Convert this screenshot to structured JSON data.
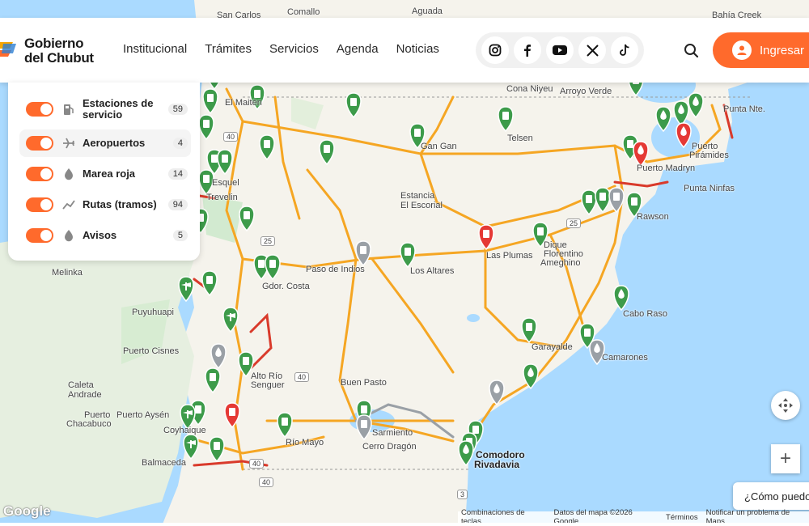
{
  "header": {
    "logo_line1": "Gobierno",
    "logo_line2": "del Chubut",
    "nav": [
      "Institucional",
      "Trámites",
      "Servicios",
      "Agenda",
      "Noticias"
    ],
    "social_icons": [
      "instagram-icon",
      "facebook-icon",
      "youtube-icon",
      "x-icon",
      "tiktok-icon"
    ],
    "login_label": "Ingresar"
  },
  "layers": [
    {
      "name": "Estaciones de servicio",
      "count": "59",
      "icon": "fuel-icon",
      "on": true
    },
    {
      "name": "Aeropuertos",
      "count": "4",
      "icon": "airplane-icon",
      "on": true
    },
    {
      "name": "Marea roja",
      "count": "14",
      "icon": "drop-icon",
      "on": true
    },
    {
      "name": "Rutas (tramos)",
      "count": "94",
      "icon": "route-icon",
      "on": true
    },
    {
      "name": "Avisos",
      "count": "5",
      "icon": "drop-icon",
      "on": true
    }
  ],
  "places": [
    "San Carlos",
    "Comallo",
    "Aguada",
    "Bahía Creek",
    "El Maitén",
    "Cona Niyeu",
    "Arroyo Verde",
    "Estancia",
    "Punta Nte.",
    "Gan Gan",
    "Telsen",
    "Puerto",
    "Pirámides",
    "Puerto Madryn",
    "Esquel",
    "Trevelin",
    "Estancia",
    "El Escorial",
    "Punta Ninfas",
    "Rawson",
    "Paso de Indios",
    "Los Altares",
    "Las Plumas",
    "Dique",
    "Florentino",
    "Ameghino",
    "Melinka",
    "Gdor. Costa",
    "Puyuhuapi",
    "Cabo Raso",
    "Puerto Cisnes",
    "Garayalde",
    "Camarones",
    "Alto Río",
    "Senguer",
    "Buen Pasto",
    "Caleta",
    "Andrade",
    "Puerto Aysén",
    "Puerto",
    "Chacabuco",
    "Coyhaique",
    "Río Mayo",
    "Sarmiento",
    "Cerro Dragón",
    "Comodoro",
    "Rivadavia",
    "Balmaceda"
  ],
  "route_shields": [
    "40",
    "25",
    "25",
    "40",
    "40",
    "3",
    "40"
  ],
  "map_controls": {
    "zoom_in": "+",
    "chat_label": "¿Cómo puedo"
  },
  "footer": {
    "google": "Google",
    "attribution": [
      "Combinaciones de teclas",
      "Datos del mapa ©2026 Google",
      "Términos",
      "Notificar un problema de Maps"
    ]
  },
  "colors": {
    "accent": "#ff6a2c",
    "marker_green": "#3d9b4a",
    "marker_red": "#e53935",
    "marker_gray": "#9aa0a6",
    "route_orange": "#f5a623",
    "route_red": "#d93a2b",
    "water": "#aadaff",
    "land": "#f5f3ec"
  }
}
